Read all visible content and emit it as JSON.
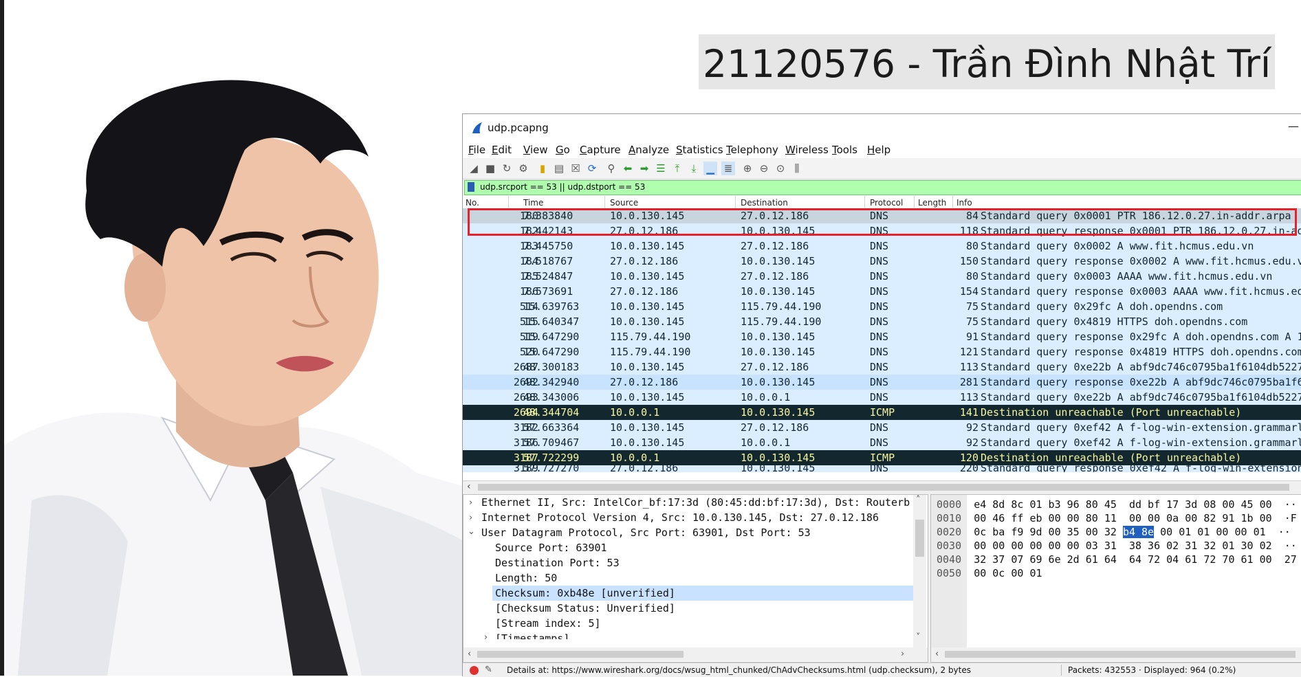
{
  "slide": {
    "title": "21120576 - Trần Đình Nhật Trí"
  },
  "window": {
    "title": "udp.pcapng",
    "minimize": "—"
  },
  "menu": [
    "File",
    "Edit",
    "View",
    "Go",
    "Capture",
    "Analyze",
    "Statistics",
    "Telephony",
    "Wireless",
    "Tools",
    "Help"
  ],
  "toolbar_icons": [
    "shark-fin-start-icon",
    "stop-icon",
    "restart-icon",
    "options-gear-icon",
    "open-file-icon",
    "save-file-icon",
    "close-file-icon",
    "reload-icon",
    "find-icon",
    "back-arrow-icon",
    "forward-arrow-icon",
    "go-to-packet-icon",
    "first-packet-icon",
    "last-packet-icon",
    "autoscroll-icon",
    "colorize-icon",
    "zoom-in-icon",
    "zoom-out-icon",
    "normal-size-icon",
    "resize-columns-icon"
  ],
  "filter": {
    "text": "udp.srcport == 53 || udp.dstport == 53"
  },
  "columns": {
    "no": "No.",
    "time": "Time",
    "source": "Source",
    "destination": "Destination",
    "protocol": "Protocol",
    "length": "Length",
    "info": "Info"
  },
  "packets": [
    {
      "no": "180",
      "time": "7.383840",
      "src": "10.0.130.145",
      "dst": "27.0.12.186",
      "proto": "DNS",
      "len": "84",
      "info": "Standard query 0x0001 PTR 186.12.0.27.in-addr.arpa",
      "style": "sel"
    },
    {
      "no": "182",
      "time": "7.442143",
      "src": "27.0.12.186",
      "dst": "10.0.130.145",
      "proto": "DNS",
      "len": "118",
      "info": "Standard query response 0x0001 PTR 186.12.0.27.in-addr.a",
      "style": "norm"
    },
    {
      "no": "183",
      "time": "7.445750",
      "src": "10.0.130.145",
      "dst": "27.0.12.186",
      "proto": "DNS",
      "len": "80",
      "info": "Standard query 0x0002 A www.fit.hcmus.edu.vn",
      "style": "norm"
    },
    {
      "no": "184",
      "time": "7.518767",
      "src": "27.0.12.186",
      "dst": "10.0.130.145",
      "proto": "DNS",
      "len": "150",
      "info": "Standard query response 0x0002 A www.fit.hcmus.edu.vn CN",
      "style": "norm"
    },
    {
      "no": "185",
      "time": "7.524847",
      "src": "10.0.130.145",
      "dst": "27.0.12.186",
      "proto": "DNS",
      "len": "80",
      "info": "Standard query 0x0003 AAAA www.fit.hcmus.edu.vn",
      "style": "norm"
    },
    {
      "no": "186",
      "time": "7.573691",
      "src": "27.0.12.186",
      "dst": "10.0.130.145",
      "proto": "DNS",
      "len": "154",
      "info": "Standard query response 0x0003 AAAA www.fit.hcmus.edu.vn",
      "style": "norm"
    },
    {
      "no": "514",
      "time": "15.639763",
      "src": "10.0.130.145",
      "dst": "115.79.44.190",
      "proto": "DNS",
      "len": "75",
      "info": "Standard query 0x29fc A doh.opendns.com",
      "style": "norm"
    },
    {
      "no": "515",
      "time": "15.640347",
      "src": "10.0.130.145",
      "dst": "115.79.44.190",
      "proto": "DNS",
      "len": "75",
      "info": "Standard query 0x4819 HTTPS doh.opendns.com",
      "style": "norm"
    },
    {
      "no": "519",
      "time": "15.647290",
      "src": "115.79.44.190",
      "dst": "10.0.130.145",
      "proto": "DNS",
      "len": "91",
      "info": "Standard query response 0x29fc A doh.opendns.com A 146.1",
      "style": "norm"
    },
    {
      "no": "520",
      "time": "15.647290",
      "src": "115.79.44.190",
      "dst": "10.0.130.145",
      "proto": "DNS",
      "len": "121",
      "info": "Standard query response 0x4819 HTTPS doh.opendns.com SOA",
      "style": "norm"
    },
    {
      "no": "2687",
      "time": "48.300183",
      "src": "10.0.130.145",
      "dst": "27.0.12.186",
      "proto": "DNS",
      "len": "113",
      "info": "Standard query 0xe22b A abf9dc746c0795ba1f6104db5227b134",
      "style": "norm"
    },
    {
      "no": "2692",
      "time": "48.342940",
      "src": "27.0.12.186",
      "dst": "10.0.130.145",
      "proto": "DNS",
      "len": "281",
      "info": "Standard query response 0xe22b A abf9dc746c0795ba1f6104c",
      "style": "alt"
    },
    {
      "no": "2693",
      "time": "48.343006",
      "src": "10.0.130.145",
      "dst": "10.0.0.1",
      "proto": "DNS",
      "len": "113",
      "info": "Standard query 0xe22b A abf9dc746c0795ba1f6104db5227b134",
      "style": "norm"
    },
    {
      "no": "2694",
      "time": "48.344704",
      "src": "10.0.0.1",
      "dst": "10.0.130.145",
      "proto": "ICMP",
      "len": "141",
      "info": "Destination unreachable (Port unreachable)",
      "style": "icmp"
    },
    {
      "no": "3182",
      "time": "57.663364",
      "src": "10.0.130.145",
      "dst": "27.0.12.186",
      "proto": "DNS",
      "len": "92",
      "info": "Standard query 0xef42 A f-log-win-extension.grammarly.ic",
      "style": "norm"
    },
    {
      "no": "3186",
      "time": "57.709467",
      "src": "10.0.130.145",
      "dst": "10.0.0.1",
      "proto": "DNS",
      "len": "92",
      "info": "Standard query 0xef42 A f-log-win-extension.grammarly.ic",
      "style": "norm"
    },
    {
      "no": "3187",
      "time": "57.722299",
      "src": "10.0.0.1",
      "dst": "10.0.130.145",
      "proto": "ICMP",
      "len": "120",
      "info": "Destination unreachable (Port unreachable)",
      "style": "icmp"
    },
    {
      "no": "3189",
      "time": "57.727270",
      "src": "27.0.12.186",
      "dst": "10.0.130.145",
      "proto": "DNS",
      "len": "220",
      "info": "Standard query response 0xef42 A f-log-win-extension.gra",
      "style": "partial"
    }
  ],
  "details": {
    "eth": "Ethernet II, Src: IntelCor_bf:17:3d (80:45:dd:bf:17:3d), Dst: Routerb",
    "ip": "Internet Protocol Version 4, Src: 10.0.130.145, Dst: 27.0.12.186",
    "udp": "User Datagram Protocol, Src Port: 63901, Dst Port: 53",
    "src_port": "Source Port: 63901",
    "dst_port": "Destination Port: 53",
    "length": "Length: 50",
    "checksum": "Checksum: 0xb48e [unverified]",
    "checksum_status": "[Checksum Status: Unverified]",
    "stream_index": "[Stream index: 5]",
    "timestamps": "[Timestamps]"
  },
  "bytes": {
    "r0_off": "0000",
    "r0_hex": "e4 8d 8c 01 b3 96 80 45  dd bf 17 3d 08 00 45 00",
    "r0_asc": "··",
    "r1_off": "0010",
    "r1_hex": "00 46 ff eb 00 00 80 11  00 00 0a 00 82 91 1b 00",
    "r1_asc": "·F",
    "r2_off": "0020",
    "r2_hex_a": "0c ba f9 9d 00 35 00 32 ",
    "r2_sel": "b4 8e",
    "r2_hex_b": " 00 01 01 00 00 01",
    "r2_asc": "··",
    "r3_off": "0030",
    "r3_hex": "00 00 00 00 00 00 03 31  38 36 02 31 32 01 30 02",
    "r3_asc": "··",
    "r4_off": "0040",
    "r4_hex": "32 37 07 69 6e 2d 61 64  64 72 04 61 72 70 61 00",
    "r4_asc": "27",
    "r5_off": "0050",
    "r5_hex": "00 0c 00 01",
    "r5_asc": ""
  },
  "status": {
    "details": "Details at: https://www.wireshark.org/docs/wsug_html_chunked/ChAdvChecksums.html (udp.checksum), 2 bytes",
    "packets": "Packets: 432553 · Displayed: 964 (0.2%)"
  },
  "colors": {
    "selected_row": "#c8d4de",
    "dns_row": "#daeeff",
    "icmp_row": "#12272e",
    "filter_bg": "#afffaf",
    "highlight_box": "#e8202a"
  }
}
